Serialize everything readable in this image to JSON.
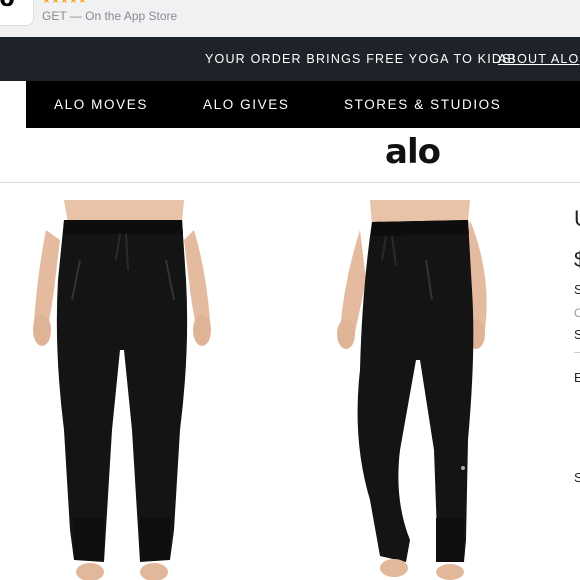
{
  "app_banner": {
    "icon_text": "lo",
    "stars": "★★★★★",
    "subtitle": "GET — On the App Store"
  },
  "promo": {
    "text": "YOUR ORDER BRINGS FREE YOGA TO KIDS!",
    "link": "ABOUT ALO"
  },
  "nav": {
    "items": [
      {
        "label": "ALO MOVES"
      },
      {
        "label": "ALO GIVES"
      },
      {
        "label": "STORES & STUDIOS"
      }
    ]
  },
  "logo": "alo",
  "product": {
    "title_fragment": "U",
    "price_fragment": "$",
    "line1_fragment": "S",
    "line2_fragment": "C",
    "line3_fragment": "S",
    "line4_fragment": "E",
    "line5_fragment": "S"
  },
  "colors": {
    "promo_bg": "#1e232a",
    "nav_bg": "#000000",
    "star": "#f5a623"
  }
}
